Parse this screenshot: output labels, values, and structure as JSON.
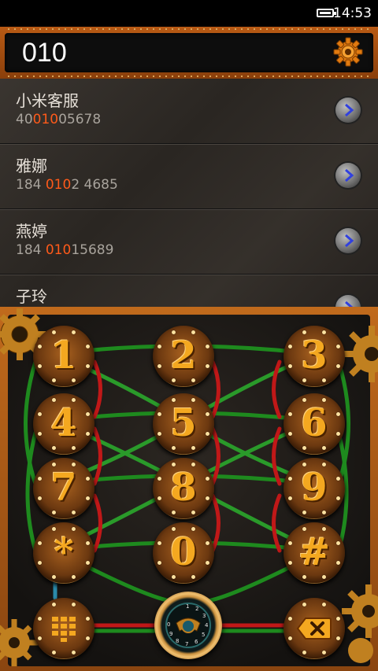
{
  "status_bar": {
    "time": "14:53"
  },
  "input": {
    "value": "010"
  },
  "contacts": [
    {
      "name": "小米客服",
      "num_pre": "40",
      "num_hl": "010",
      "num_post": "05678"
    },
    {
      "name": "雅娜",
      "num_pre": "184 ",
      "num_hl": "010",
      "num_post": "2 4685"
    },
    {
      "name": "燕婷",
      "num_pre": "184 ",
      "num_hl": "010",
      "num_post": "15689"
    },
    {
      "name": "子玲",
      "num_pre": "",
      "num_hl": "",
      "num_post": ""
    }
  ],
  "keypad": {
    "keys": [
      "1",
      "2",
      "3",
      "4",
      "5",
      "6",
      "7",
      "8",
      "9",
      "*",
      "0",
      "#"
    ],
    "bottom": {
      "left_icon": "dialpad-grid-icon",
      "center_icon": "rotary-dial-call-icon",
      "right_icon": "backspace-icon"
    }
  },
  "colors": {
    "highlight": "#ff5a1a",
    "frame": "#b85a14",
    "key_digit": "#f4a820"
  }
}
